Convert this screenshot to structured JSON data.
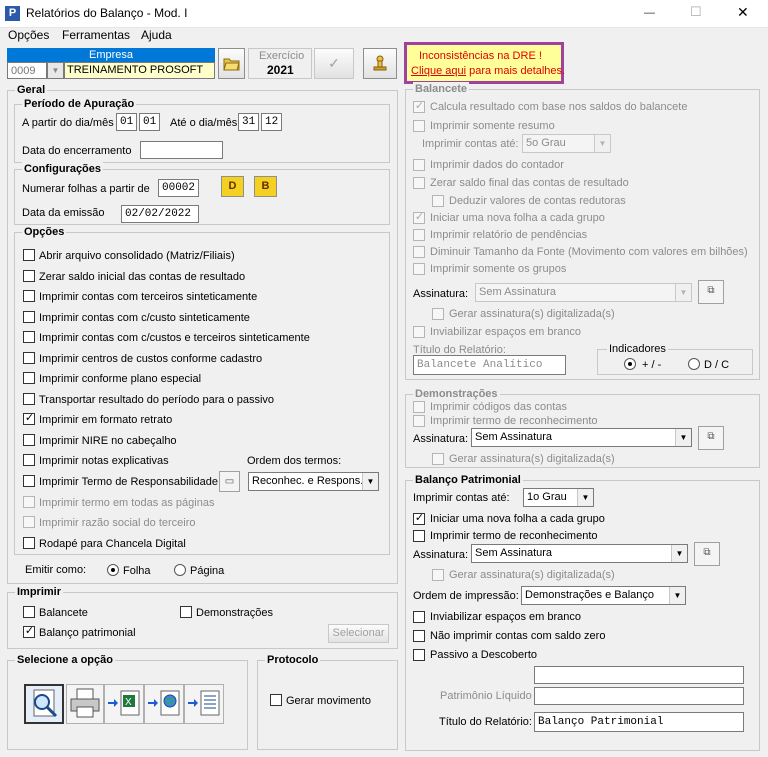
{
  "window": {
    "title": "Relatórios do Balanço - Mod. I",
    "minimize": "—",
    "maximize": "☐",
    "close": "✕"
  },
  "menu": [
    "Opções",
    "Ferramentas",
    "Ajuda"
  ],
  "empresa": {
    "header": "Empresa",
    "code": "0009",
    "name": "TREINAMENTO PROSOFT"
  },
  "exercicio": {
    "header": "Exercício",
    "year": "2021"
  },
  "warning": {
    "line1": "Inconsistências na DRE !",
    "link": "Clique aqui",
    "line2_rest": " para mais detalhes."
  },
  "geral": {
    "title": "Geral",
    "periodo": {
      "title": "Período de Apuração",
      "from_label": "A partir do dia/mês",
      "from_day": "01",
      "from_month": "01",
      "to_label": "Até o dia/mês",
      "to_day": "31",
      "to_month": "12",
      "closing_label": "Data do encerramento",
      "closing_value": ""
    },
    "config": {
      "title": "Configurações",
      "numerar_label": "Numerar folhas a partir de",
      "numerar_value": "00002",
      "btn_d": "D",
      "btn_b": "B",
      "emissao_label": "Data da emissão",
      "emissao_value": "02/02/2022"
    },
    "opcoes": {
      "title": "Opções",
      "items": [
        {
          "label": "Abrir arquivo consolidado (Matriz/Filiais)",
          "checked": false,
          "enabled": true
        },
        {
          "label": "Zerar saldo inicial das contas de resultado",
          "checked": false,
          "enabled": true
        },
        {
          "label": "Imprimir contas com terceiros sinteticamente",
          "checked": false,
          "enabled": true
        },
        {
          "label": "Imprimir contas com c/custo sinteticamente",
          "checked": false,
          "enabled": true
        },
        {
          "label": "Imprimir contas com c/custos e terceiros sinteticamente",
          "checked": false,
          "enabled": true
        },
        {
          "label": "Imprimir centros de custos conforme cadastro",
          "checked": false,
          "enabled": true
        },
        {
          "label": "Imprimir conforme plano especial",
          "checked": false,
          "enabled": true
        },
        {
          "label": "Transportar resultado do período para o passivo",
          "checked": false,
          "enabled": true
        },
        {
          "label": "Imprimir em formato retrato",
          "checked": true,
          "enabled": true
        },
        {
          "label": "Imprimir NIRE no cabeçalho",
          "checked": false,
          "enabled": true
        },
        {
          "label": "Imprimir notas explicativas",
          "checked": false,
          "enabled": true
        },
        {
          "label": "Imprimir Termo de Responsabilidade",
          "checked": false,
          "enabled": true
        },
        {
          "label": "Imprimir termo em todas as páginas",
          "checked": false,
          "enabled": false
        },
        {
          "label": "Imprimir razão social do terceiro",
          "checked": false,
          "enabled": false
        },
        {
          "label": "Rodapé para Chancela Digital",
          "checked": false,
          "enabled": true
        }
      ],
      "ordem_label": "Ordem dos termos:",
      "ordem_value": "Reconhec. e Respons."
    },
    "emitir": {
      "label": "Emitir como:",
      "folha": "Folha",
      "pagina": "Página",
      "selected": "Folha"
    }
  },
  "imprimir": {
    "title": "Imprimir",
    "balancete": "Balancete",
    "demonstracoes": "Demonstrações",
    "balanco": "Balanço patrimonial",
    "balanco_checked": true,
    "selecionar": "Selecionar"
  },
  "selecione": {
    "title": "Selecione a opção",
    "icons": [
      "preview-icon",
      "printer-icon",
      "excel-export-icon",
      "web-export-icon",
      "document-export-icon"
    ]
  },
  "protocolo": {
    "title": "Protocolo",
    "gerar": "Gerar movimento"
  },
  "balancete": {
    "title": "Balancete",
    "items": [
      {
        "label": "Calcula resultado com base nos saldos do balancete",
        "checked": true
      },
      {
        "label": "Imprimir somente resumo",
        "checked": false
      },
      {
        "label": "Imprimir dados do contador",
        "checked": false
      },
      {
        "label": "Zerar saldo final das contas de resultado",
        "checked": false
      },
      {
        "label": "Deduzir valores de contas redutoras",
        "checked": false
      },
      {
        "label": "Iniciar uma nova folha a cada grupo",
        "checked": true
      },
      {
        "label": "Imprimir relatório de pendências",
        "checked": false
      },
      {
        "label": "Diminuir Tamanho da Fonte (Movimento com valores em bilhões)",
        "checked": false
      },
      {
        "label": "Imprimir somente os grupos",
        "checked": false
      }
    ],
    "contas_label": "Imprimir contas até:",
    "contas_value": "5o Grau",
    "assinatura_label": "Assinatura:",
    "assinatura_value": "Sem Assinatura",
    "gerar_dig": "Gerar assinatura(s) digitalizada(s)",
    "inviabilizar": "Inviabilizar espaços em branco",
    "titulo_label": "Título do Relatório:",
    "titulo_value": "Balancete Analítico",
    "indicadores": {
      "title": "Indicadores",
      "opt1": "+ / -",
      "opt2": "D / C",
      "selected": "+ / -"
    }
  },
  "demonstracoes": {
    "title": "Demonstrações",
    "codigos": "Imprimir códigos das contas",
    "termo": "Imprimir termo de reconhecimento",
    "assinatura_label": "Assinatura:",
    "assinatura_value": "Sem Assinatura",
    "gerar_dig": "Gerar assinatura(s) digitalizada(s)"
  },
  "balanco": {
    "title": "Balanço Patrimonial",
    "contas_label": "Imprimir contas até:",
    "contas_value": "1o Grau",
    "nova_folha": "Iniciar uma nova folha a cada grupo",
    "nova_folha_checked": true,
    "termo": "Imprimir termo de reconhecimento",
    "assinatura_label": "Assinatura:",
    "assinatura_value": "Sem Assinatura",
    "gerar_dig": "Gerar assinatura(s) digitalizada(s)",
    "ordem_label": "Ordem de impressão:",
    "ordem_value": "Demonstrações e Balanço",
    "inviabilizar": "Inviabilizar espaços em branco",
    "nao_imprimir": "Não imprimir contas com saldo zero",
    "passivo": "Passivo a Descoberto",
    "passivo_value": "",
    "pl_label": "Patrimônio Líquido",
    "pl_value": "",
    "titulo_label": "Título do Relatório:",
    "titulo_value": "Balanço Patrimonial"
  },
  "colors": {
    "accent": "#0078d7",
    "warning_border": "#a040a0",
    "warning_bg": "#ffff99",
    "warning_text": "#e00000"
  }
}
